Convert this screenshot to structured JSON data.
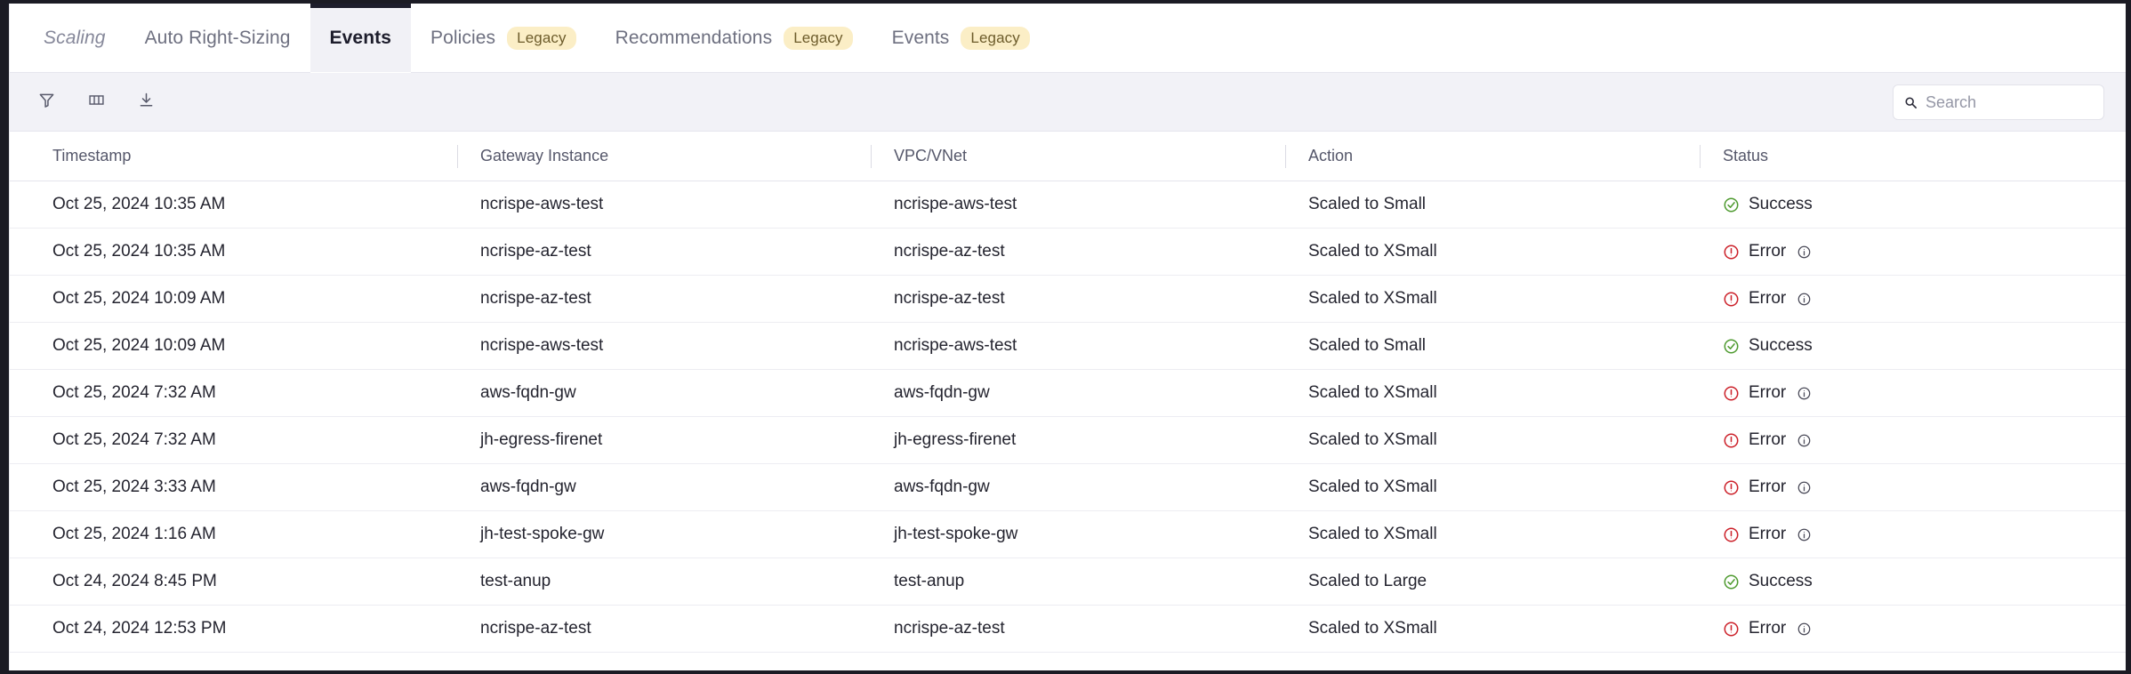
{
  "tabs": [
    {
      "label": "Scaling",
      "style": "italic",
      "badge": null,
      "active": false
    },
    {
      "label": "Auto Right-Sizing",
      "style": "normal",
      "badge": null,
      "active": false
    },
    {
      "label": "Events",
      "style": "normal",
      "badge": null,
      "active": true
    },
    {
      "label": "Policies",
      "style": "normal",
      "badge": "Legacy",
      "active": false
    },
    {
      "label": "Recommendations",
      "style": "normal",
      "badge": "Legacy",
      "active": false
    },
    {
      "label": "Events",
      "style": "normal",
      "badge": "Legacy",
      "active": false
    }
  ],
  "toolbar": {
    "filter_icon": "filter-icon",
    "columns_icon": "columns-icon",
    "download_icon": "download-icon"
  },
  "search": {
    "placeholder": "Search",
    "value": "",
    "icon": "search-icon"
  },
  "table": {
    "columns": [
      "Timestamp",
      "Gateway Instance",
      "VPC/VNet",
      "Action",
      "Status"
    ],
    "rows": [
      {
        "timestamp": "Oct 25, 2024 10:35 AM",
        "gateway": "ncrispe-aws-test",
        "vpc": "ncrispe-aws-test",
        "action": "Scaled to Small",
        "status": "Success",
        "status_type": "success",
        "info": false
      },
      {
        "timestamp": "Oct 25, 2024 10:35 AM",
        "gateway": "ncrispe-az-test",
        "vpc": "ncrispe-az-test",
        "action": "Scaled to XSmall",
        "status": "Error",
        "status_type": "error",
        "info": true
      },
      {
        "timestamp": "Oct 25, 2024 10:09 AM",
        "gateway": "ncrispe-az-test",
        "vpc": "ncrispe-az-test",
        "action": "Scaled to XSmall",
        "status": "Error",
        "status_type": "error",
        "info": true
      },
      {
        "timestamp": "Oct 25, 2024 10:09 AM",
        "gateway": "ncrispe-aws-test",
        "vpc": "ncrispe-aws-test",
        "action": "Scaled to Small",
        "status": "Success",
        "status_type": "success",
        "info": false
      },
      {
        "timestamp": "Oct 25, 2024 7:32 AM",
        "gateway": "aws-fqdn-gw",
        "vpc": "aws-fqdn-gw",
        "action": "Scaled to XSmall",
        "status": "Error",
        "status_type": "error",
        "info": true
      },
      {
        "timestamp": "Oct 25, 2024 7:32 AM",
        "gateway": "jh-egress-firenet",
        "vpc": "jh-egress-firenet",
        "action": "Scaled to XSmall",
        "status": "Error",
        "status_type": "error",
        "info": true
      },
      {
        "timestamp": "Oct 25, 2024 3:33 AM",
        "gateway": "aws-fqdn-gw",
        "vpc": "aws-fqdn-gw",
        "action": "Scaled to XSmall",
        "status": "Error",
        "status_type": "error",
        "info": true
      },
      {
        "timestamp": "Oct 25, 2024 1:16 AM",
        "gateway": "jh-test-spoke-gw",
        "vpc": "jh-test-spoke-gw",
        "action": "Scaled to XSmall",
        "status": "Error",
        "status_type": "error",
        "info": true
      },
      {
        "timestamp": "Oct 24, 2024 8:45 PM",
        "gateway": "test-anup",
        "vpc": "test-anup",
        "action": "Scaled to Large",
        "status": "Success",
        "status_type": "success",
        "info": false
      },
      {
        "timestamp": "Oct 24, 2024 12:53 PM",
        "gateway": "ncrispe-az-test",
        "vpc": "ncrispe-az-test",
        "action": "Scaled to XSmall",
        "status": "Error",
        "status_type": "error",
        "info": true
      }
    ]
  },
  "colors": {
    "success": "#4e9a2f",
    "error": "#cc2029",
    "badge_bg": "#fbeec6",
    "badge_text": "#6d5c2b",
    "active_tab": "#1d1d2c",
    "toolbar_bg": "#f2f2f7"
  }
}
